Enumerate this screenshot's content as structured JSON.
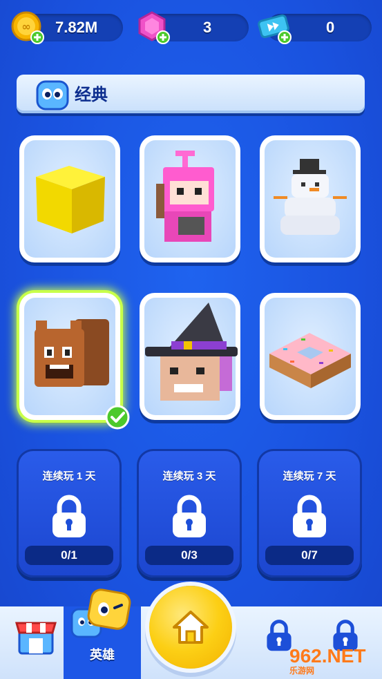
{
  "currency": {
    "coins": "7.82M",
    "gems": "3",
    "tickets": "0"
  },
  "category": {
    "title": "经典"
  },
  "characters": [
    {
      "name": "yellow-cube",
      "selected": false
    },
    {
      "name": "pink-robot",
      "selected": false
    },
    {
      "name": "snowman",
      "selected": false
    },
    {
      "name": "squirrel",
      "selected": true
    },
    {
      "name": "witch",
      "selected": false
    },
    {
      "name": "donut",
      "selected": false
    }
  ],
  "locked": [
    {
      "title": "连续玩 1 天",
      "progress": "0/1"
    },
    {
      "title": "连续玩 3 天",
      "progress": "0/3"
    },
    {
      "title": "连续玩 7 天",
      "progress": "0/7"
    }
  ],
  "nav": {
    "heroes_label": "英雄"
  },
  "watermark": {
    "brand": "962.NET",
    "sub": "乐游网"
  },
  "colors": {
    "background": "#1a52df",
    "accent_yellow": "#fccf15",
    "selected_glow": "#c8ff4a"
  }
}
